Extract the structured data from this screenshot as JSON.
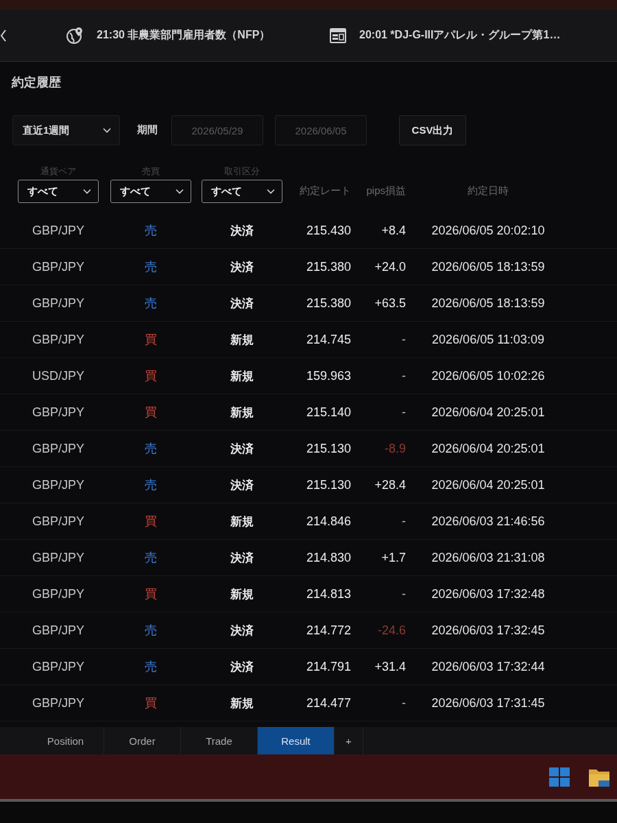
{
  "news_bar": {
    "items": [
      {
        "kind": "globe",
        "text": "21:30 非農業部門雇用者数（NFP）"
      },
      {
        "kind": "newspaper",
        "text": "20:01 *DJ-G-IIIアパレル・グループ第1…"
      }
    ]
  },
  "title": "約定履歴",
  "period_filter": {
    "preset": "直近1週間",
    "label": "期間",
    "from": "2026/05/29",
    "to": "2026/06/05",
    "disabled": true
  },
  "export_button": "CSV出力",
  "table": {
    "columns": [
      {
        "label": "通貨ペア",
        "kind": "select",
        "value": "すべて"
      },
      {
        "label": "売買",
        "kind": "select",
        "value": "すべて"
      },
      {
        "label": "取引区分",
        "kind": "select",
        "value": "すべて"
      },
      {
        "label": "約定レート",
        "kind": "text"
      },
      {
        "label": "pips損益",
        "kind": "text"
      },
      {
        "label": "約定日時",
        "kind": "text"
      }
    ],
    "rows": [
      {
        "pair": "GBP/JPY",
        "side": {
          "text": "売",
          "kind": "sell"
        },
        "type": "決済",
        "rate": "215.430",
        "pips": {
          "text": "+8.4",
          "kind": "profit"
        },
        "time": "2026/06/05 20:02:10"
      },
      {
        "pair": "GBP/JPY",
        "side": {
          "text": "売",
          "kind": "sell"
        },
        "type": "決済",
        "rate": "215.380",
        "pips": {
          "text": "+24.0",
          "kind": "profit"
        },
        "time": "2026/06/05 18:13:59"
      },
      {
        "pair": "GBP/JPY",
        "side": {
          "text": "売",
          "kind": "sell"
        },
        "type": "決済",
        "rate": "215.380",
        "pips": {
          "text": "+63.5",
          "kind": "profit"
        },
        "time": "2026/06/05 18:13:59"
      },
      {
        "pair": "GBP/JPY",
        "side": {
          "text": "買",
          "kind": "buy"
        },
        "type": "新規",
        "rate": "214.745",
        "pips": {
          "text": "-",
          "kind": "none"
        },
        "time": "2026/06/05 11:03:09"
      },
      {
        "pair": "USD/JPY",
        "side": {
          "text": "買",
          "kind": "buy"
        },
        "type": "新規",
        "rate": "159.963",
        "pips": {
          "text": "-",
          "kind": "none"
        },
        "time": "2026/06/05 10:02:26"
      },
      {
        "pair": "GBP/JPY",
        "side": {
          "text": "買",
          "kind": "buy"
        },
        "type": "新規",
        "rate": "215.140",
        "pips": {
          "text": "-",
          "kind": "none"
        },
        "time": "2026/06/04 20:25:01"
      },
      {
        "pair": "GBP/JPY",
        "side": {
          "text": "売",
          "kind": "sell"
        },
        "type": "決済",
        "rate": "215.130",
        "pips": {
          "text": "-8.9",
          "kind": "loss"
        },
        "time": "2026/06/04 20:25:01"
      },
      {
        "pair": "GBP/JPY",
        "side": {
          "text": "売",
          "kind": "sell"
        },
        "type": "決済",
        "rate": "215.130",
        "pips": {
          "text": "+28.4",
          "kind": "profit"
        },
        "time": "2026/06/04 20:25:01"
      },
      {
        "pair": "GBP/JPY",
        "side": {
          "text": "買",
          "kind": "buy"
        },
        "type": "新規",
        "rate": "214.846",
        "pips": {
          "text": "-",
          "kind": "none"
        },
        "time": "2026/06/03 21:46:56"
      },
      {
        "pair": "GBP/JPY",
        "side": {
          "text": "売",
          "kind": "sell"
        },
        "type": "決済",
        "rate": "214.830",
        "pips": {
          "text": "+1.7",
          "kind": "profit"
        },
        "time": "2026/06/03 21:31:08"
      },
      {
        "pair": "GBP/JPY",
        "side": {
          "text": "買",
          "kind": "buy"
        },
        "type": "新規",
        "rate": "214.813",
        "pips": {
          "text": "-",
          "kind": "none"
        },
        "time": "2026/06/03 17:32:48"
      },
      {
        "pair": "GBP/JPY",
        "side": {
          "text": "売",
          "kind": "sell"
        },
        "type": "決済",
        "rate": "214.772",
        "pips": {
          "text": "-24.6",
          "kind": "loss"
        },
        "time": "2026/06/03 17:32:45"
      },
      {
        "pair": "GBP/JPY",
        "side": {
          "text": "売",
          "kind": "sell"
        },
        "type": "決済",
        "rate": "214.791",
        "pips": {
          "text": "+31.4",
          "kind": "profit"
        },
        "time": "2026/06/03 17:32:44"
      },
      {
        "pair": "GBP/JPY",
        "side": {
          "text": "買",
          "kind": "buy"
        },
        "type": "新規",
        "rate": "214.477",
        "pips": {
          "text": "-",
          "kind": "none"
        },
        "time": "2026/06/03 17:31:45"
      }
    ]
  },
  "tabs": [
    {
      "label": "Position",
      "selected": false
    },
    {
      "label": "Order",
      "selected": false
    },
    {
      "label": "Trade",
      "selected": false
    },
    {
      "label": "Result",
      "selected": true
    }
  ],
  "add_tab": "+"
}
